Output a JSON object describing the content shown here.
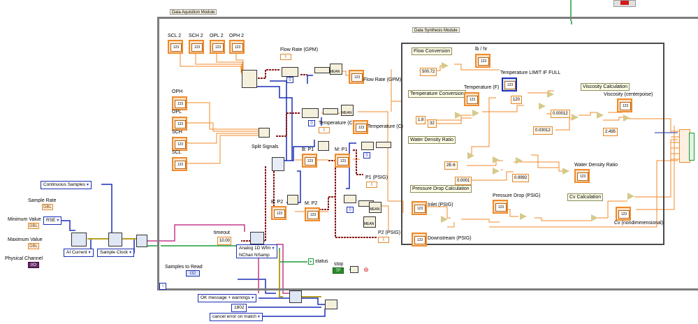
{
  "modules": {
    "acquisition": "Data Aquisition Module",
    "synthesis": "Data Synthesis Module"
  },
  "inputs": {
    "scl2": "SCL 2",
    "sch2": "SCH 2",
    "opl2": "OPL 2",
    "oph2": "OPH 2",
    "oph": "OPH",
    "opl": "OPL",
    "sch": "SCH",
    "scl": "SCL"
  },
  "left": {
    "continuous_samples": "Continuous Samples",
    "sample_rate": "Sample Rate",
    "minimum_value": "Minimum Value",
    "maximum_value": "Maximum Value",
    "physical_channel": "Physical Channel",
    "rse": "RSE",
    "ai_current": "AI Current",
    "sample_clock": "Sample Clock"
  },
  "acq": {
    "flow_rate_gpm_top": "Flow Rate (GPM)",
    "flow_rate_gpm": "Flow Rate (GPM)",
    "temperature_c_mid": "Temperature (C)",
    "temperature_c": "Temperature (C)",
    "split_signals": "Split Signals",
    "b_p1": "B: P1",
    "m_p1": "M: P1",
    "b_p2": "B: P2",
    "m_p2": "M: P2",
    "p1_psig": "P1 (PSIG)",
    "p2_psig": "P2 (PSIG)",
    "mean": "MEAN",
    "timeout": "timeout",
    "timeout_value": "10.00",
    "samples_to_read": "Samples to Read",
    "analog_1d_line1": "Analog 1D Wfm",
    "analog_1d_line2": "NChan NSamp",
    "status": "status",
    "stop": "stop",
    "tf": "TF",
    "loop_index": "i"
  },
  "synthesis": {
    "flow_conversion": "Flow Conversion",
    "lb_hr": "lb / hr",
    "c_500": "500.72",
    "temp_limit": "Temperature LIMIT IF FULL",
    "temp_conversion": "Temperature Conversion",
    "temperature_f": "Temperature (F)",
    "c_1_8": "1.8",
    "c_32": "32",
    "c_120": "120",
    "viscosity_calc": "Viscosity Calculation",
    "viscosity": "Viscosity (centerpoise)",
    "c_00012": "0.00012",
    "c_03012": "0.03012",
    "c_2495": "2.495",
    "water_density_ratio_hdr": "Water Density Ratio",
    "c_2e6": "2E-6",
    "c_9992": "0.9992",
    "c_0001": "0.0001",
    "water_density_ratio": "Water Density Ratio",
    "pressure_drop_calc": "Pressure Drop Calculation",
    "pressure_drop": "Pressure Drop (PSIG)",
    "inlet": "Inlet (PSIG)",
    "downstream": "Downstream (PSIG)",
    "cv_calc": "Cv Calculation",
    "cv": "Cv (nondimmensional)"
  },
  "error": {
    "ok_msg": "OK message + warnings",
    "code": "1802",
    "cancel": "cancel error on match"
  },
  "colors": {
    "orange_wire": "#f08a2a",
    "blue_wire": "#1a2fb5",
    "pink_wire": "#c43a8a",
    "green_wire": "#1a9a3a",
    "dark_red_wire": "#8a1a1a"
  }
}
